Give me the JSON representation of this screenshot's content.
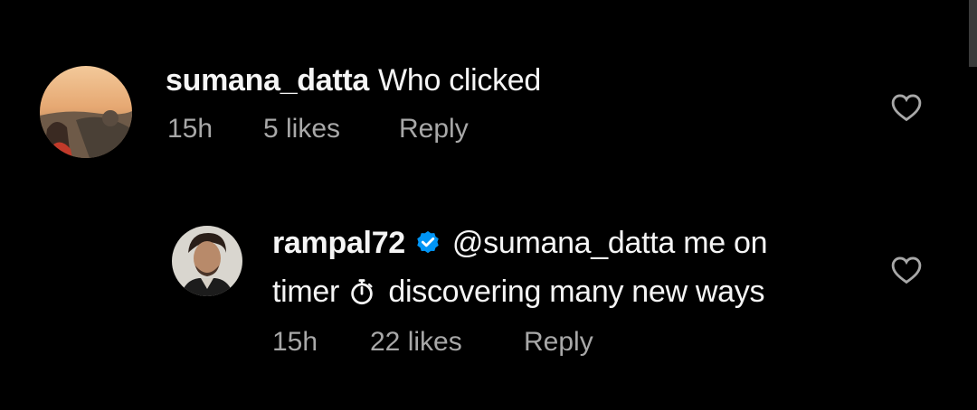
{
  "comments": [
    {
      "username": "sumana_datta",
      "text": "Who clicked",
      "time": "15h",
      "likes": "5 likes",
      "reply": "Reply",
      "avatar_icon": "profile-photo-sunset"
    },
    {
      "username": "rampal72",
      "verified": true,
      "mention": "@sumana_datta",
      "text_line1_rest": "me on",
      "text_line2_start": "timer",
      "emoji": "⏱",
      "text_line2_end": "discovering many new ways",
      "time": "15h",
      "likes": "22 likes",
      "reply": "Reply",
      "avatar_icon": "profile-photo-man"
    }
  ],
  "colors": {
    "background": "#000000",
    "primary_text": "#f5f5f5",
    "secondary_text": "#a8a8a8",
    "verified_blue": "#0095f6"
  },
  "icons": [
    "heart-outline-icon",
    "verified-badge-icon",
    "stopwatch-icon"
  ]
}
